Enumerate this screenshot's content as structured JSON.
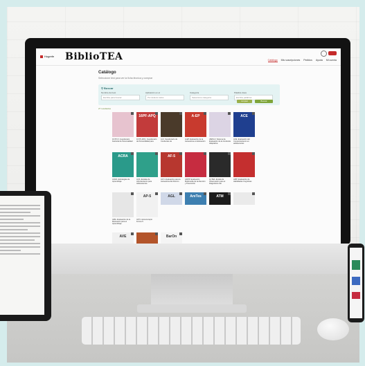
{
  "app": {
    "publisher": "Hogrefe",
    "brand": "BiblioTEA",
    "nav": [
      "Catálogo",
      "Mis suscripciones",
      "Pedidos",
      "Ayuda",
      "Mi cuenta"
    ],
    "login_label": "Login"
  },
  "catalog": {
    "title": "Catálogo",
    "subtitle": "Seleccione test para ver la ficha técnica y comprar",
    "search_title": "Buscar",
    "fields": [
      {
        "label": "Nombre del test",
        "placeholder": "Escriba para buscar"
      },
      {
        "label": "Aplicación en el",
        "value": "Por defecto todos"
      },
      {
        "label": "Categoría",
        "value": "Seleccione categoría"
      },
      {
        "label": "Palabra clave",
        "placeholder": "Escriba palabras"
      }
    ],
    "buttons": {
      "clear": "Limpiar",
      "search": "Buscar"
    },
    "results_count": "27 resultados",
    "items": [
      {
        "cover": "",
        "caption": "16 PF-5. Cuestionario Factorial de Personalidad",
        "color": "#e7c3cf"
      },
      {
        "cover": "16PF-APQ",
        "caption": "16 PF-APQ. Cuestionario de Personalidad para",
        "color": "#c23b3b"
      },
      {
        "cover": "",
        "caption": "A-D. Cuestionario de Conductas de",
        "color": "#4a3a2a"
      },
      {
        "cover": "A-EP",
        "caption": "A-EP. Evaluación de la Autoestima en Educación",
        "color": "#c83a2e"
      },
      {
        "cover": "",
        "caption": "ABAS-II. Sistema de Evaluación de la Conducta Adaptativa",
        "color": "#dcd4e4"
      },
      {
        "cover": "ACE",
        "caption": "ACE. Evaluación del Comportamiento en adolescentes",
        "color": "#1f3f8f"
      },
      {
        "cover": "ACRA",
        "caption": "ACRA. Estrategias de Aprendizaje",
        "color": "#2a9a8a"
      },
      {
        "cover": "",
        "caption": "ACS. Escalas de Afrontamiento para Adolescentes",
        "color": "#2fa08a"
      },
      {
        "cover": "AF-5",
        "caption": "AF-5. Evaluación para la Autoestima del Alumno",
        "color": "#b7372f"
      },
      {
        "cover": "",
        "caption": "AFIPP. Evaluación Multimedia de la Atención y Prevención",
        "color": "#c62c40"
      },
      {
        "cover": "",
        "caption": "AI-TEA. Escala de Observación para el Diagnóstico del",
        "color": "#2a2a2a"
      },
      {
        "cover": "",
        "caption": "AIPP. Evaluación de Habilidades Cognitivas",
        "color": "#c42f2f"
      },
      {
        "cover": "",
        "caption": "AMA. Evaluación de la Motivación para el Aprendizaje",
        "color": "#e6e6e6"
      },
      {
        "cover": "AP-5",
        "caption": "AP-5. Autoconcepto Forma 5",
        "color": "#f1f1f1"
      },
      {
        "cover": "AGL",
        "caption": "",
        "color": "#d0d8e8"
      },
      {
        "cover": "AreTes",
        "caption": "",
        "color": "#3d7fb0"
      },
      {
        "cover": "ATM",
        "caption": "",
        "color": "#1c1c1c"
      },
      {
        "cover": "",
        "caption": "",
        "color": "#eaeaea"
      },
      {
        "cover": "AVE",
        "caption": "",
        "color": "#f0f0f0"
      },
      {
        "cover": "",
        "caption": "",
        "color": "#b3542a"
      },
      {
        "cover": "BarOn",
        "caption": "",
        "color": "#f4f4f4"
      }
    ]
  }
}
